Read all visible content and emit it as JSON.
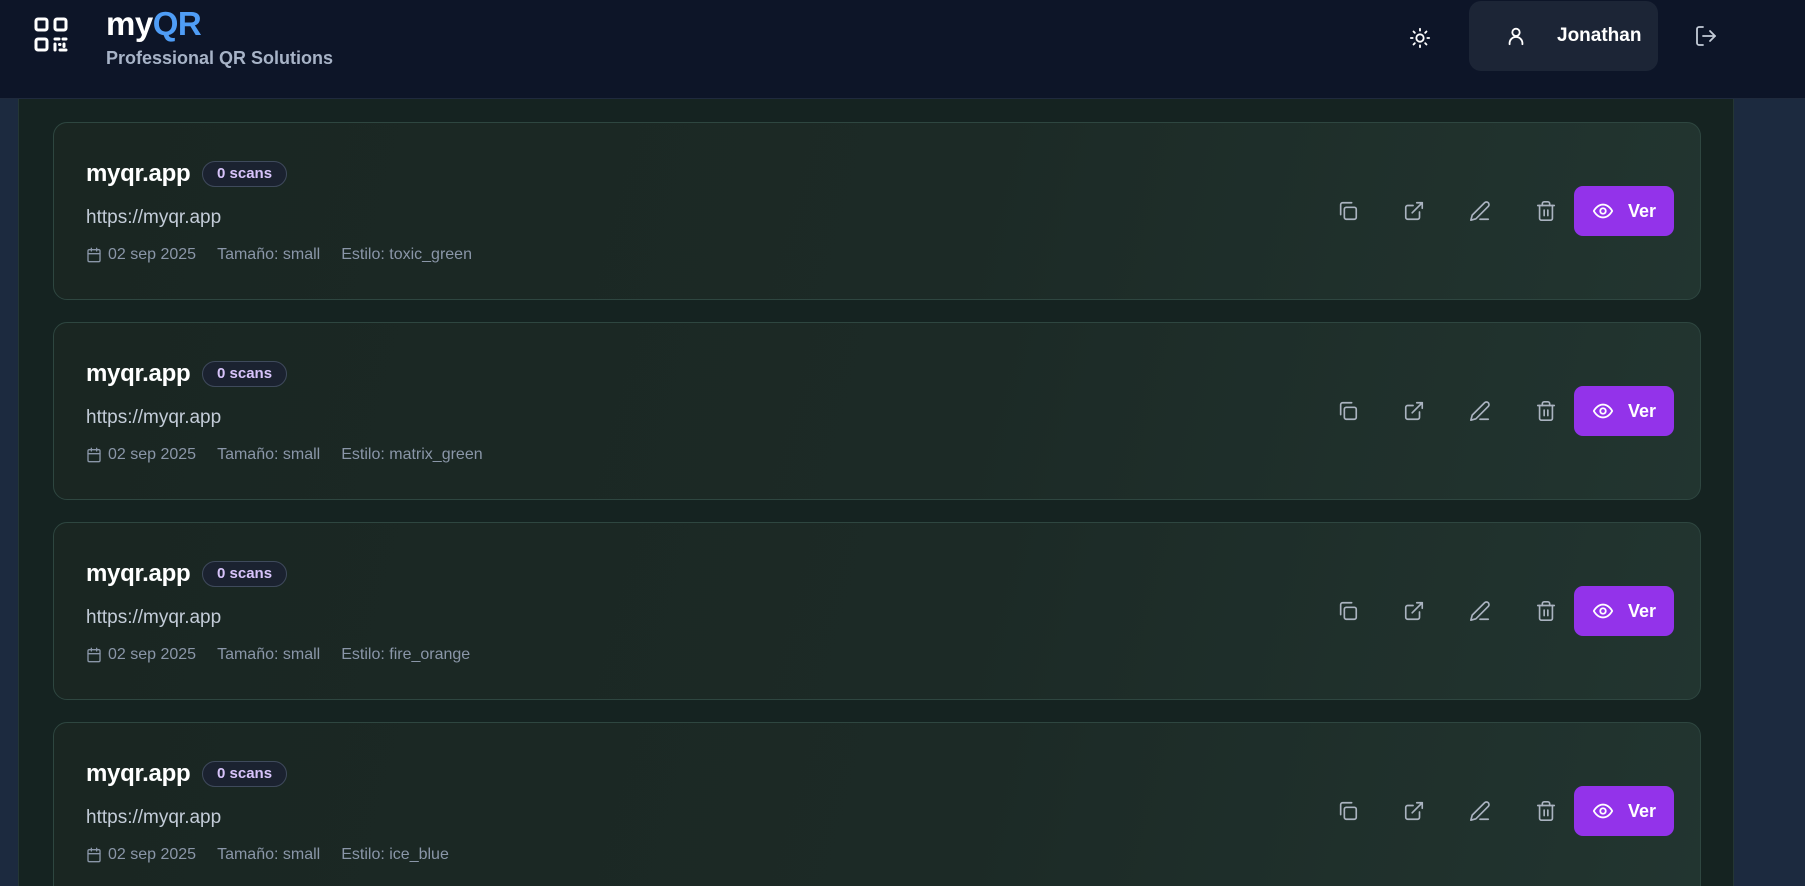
{
  "header": {
    "brand_prefix": "my",
    "brand_suffix": "QR",
    "tagline": "Professional QR Solutions",
    "user_name": "Jonathan",
    "icons": {
      "logo": "qr-code-icon",
      "theme": "sun-icon",
      "user": "user-icon",
      "logout": "logout-icon"
    }
  },
  "colors": {
    "accent": "#9333ea",
    "brand": "#4f9df6",
    "badge_text": "#d8c4fb"
  },
  "qr_list": [
    {
      "title": "myqr.app",
      "scans": "0 scans",
      "url": "https://myqr.app",
      "date": "02 sep 2025",
      "size": "Tamaño: small",
      "style": "Estilo: toxic_green",
      "view_label": "Ver"
    },
    {
      "title": "myqr.app",
      "scans": "0 scans",
      "url": "https://myqr.app",
      "date": "02 sep 2025",
      "size": "Tamaño: small",
      "style": "Estilo: matrix_green",
      "view_label": "Ver"
    },
    {
      "title": "myqr.app",
      "scans": "0 scans",
      "url": "https://myqr.app",
      "date": "02 sep 2025",
      "size": "Tamaño: small",
      "style": "Estilo: fire_orange",
      "view_label": "Ver"
    },
    {
      "title": "myqr.app",
      "scans": "0 scans",
      "url": "https://myqr.app",
      "date": "02 sep 2025",
      "size": "Tamaño: small",
      "style": "Estilo: ice_blue",
      "view_label": "Ver"
    }
  ],
  "card_icons": [
    "copy-icon",
    "external-link-icon",
    "edit-pencil-icon",
    "trash-icon",
    "eye-icon",
    "calendar-icon"
  ]
}
